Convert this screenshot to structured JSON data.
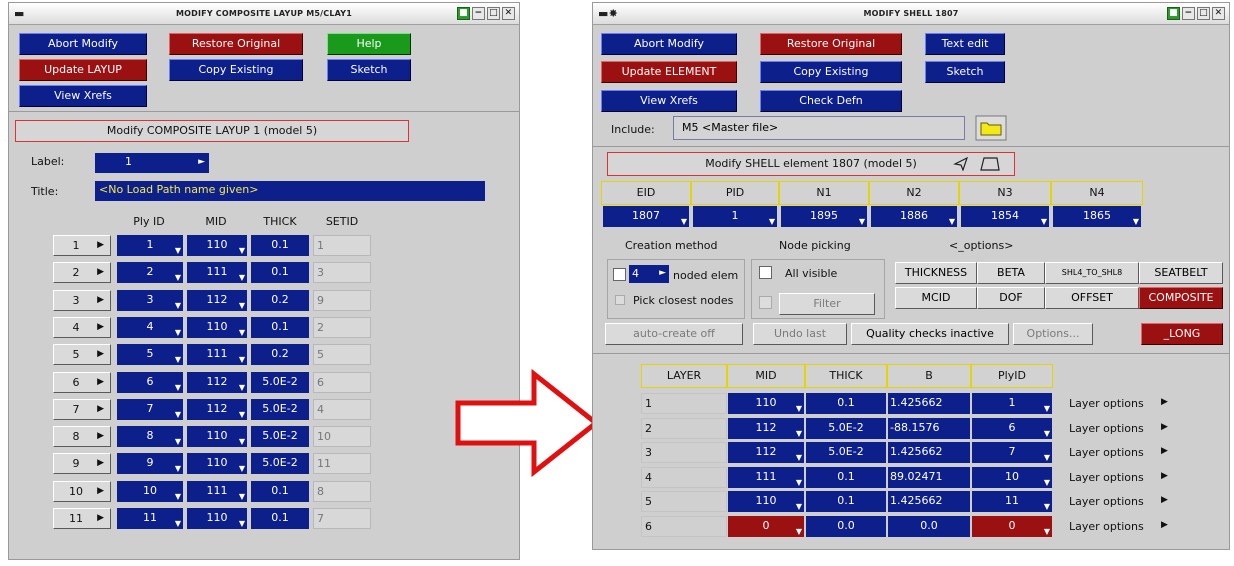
{
  "left_window": {
    "title": "MODIFY COMPOSITE LAYUP M5/CLAY1",
    "buttons": {
      "abort": "Abort Modify",
      "restore": "Restore Original",
      "help": "Help",
      "update": "Update LAYUP",
      "copy": "Copy Existing",
      "sketch": "Sketch",
      "xrefs": "View Xrefs"
    },
    "heading": "Modify COMPOSITE LAYUP 1 (model 5)",
    "label_caption": "Label:",
    "label_value": "1",
    "title_caption": "Title:",
    "title_value": "<No Load Path name given>",
    "columns": [
      "Ply ID",
      "MID",
      "THICK",
      "SETID"
    ],
    "plies": [
      {
        "row": "1",
        "ply": "1",
        "mid": "110",
        "thick": "0.1",
        "setid": "1"
      },
      {
        "row": "2",
        "ply": "2",
        "mid": "111",
        "thick": "0.1",
        "setid": "3"
      },
      {
        "row": "3",
        "ply": "3",
        "mid": "112",
        "thick": "0.2",
        "setid": "9"
      },
      {
        "row": "4",
        "ply": "4",
        "mid": "110",
        "thick": "0.1",
        "setid": "2"
      },
      {
        "row": "5",
        "ply": "5",
        "mid": "111",
        "thick": "0.2",
        "setid": "5"
      },
      {
        "row": "6",
        "ply": "6",
        "mid": "112",
        "thick": "5.0E-2",
        "setid": "6"
      },
      {
        "row": "7",
        "ply": "7",
        "mid": "112",
        "thick": "5.0E-2",
        "setid": "4"
      },
      {
        "row": "8",
        "ply": "8",
        "mid": "110",
        "thick": "5.0E-2",
        "setid": "10"
      },
      {
        "row": "9",
        "ply": "9",
        "mid": "110",
        "thick": "5.0E-2",
        "setid": "11"
      },
      {
        "row": "10",
        "ply": "10",
        "mid": "111",
        "thick": "0.1",
        "setid": "8"
      },
      {
        "row": "11",
        "ply": "11",
        "mid": "110",
        "thick": "0.1",
        "setid": "7"
      }
    ]
  },
  "right_window": {
    "title": "MODIFY SHELL 1807",
    "buttons": {
      "abort": "Abort Modify",
      "restore": "Restore Original",
      "text_edit": "Text edit",
      "update": "Update ELEMENT",
      "copy": "Copy Existing",
      "sketch": "Sketch",
      "xrefs": "View Xrefs",
      "check": "Check Defn"
    },
    "include_caption": "Include:",
    "include_value": "M5 <Master file>",
    "heading": "Modify SHELL element 1807 (model 5)",
    "element_headers": [
      "EID",
      "PID",
      "N1",
      "N2",
      "N3",
      "N4"
    ],
    "element_values": [
      "1807",
      "1",
      "1895",
      "1886",
      "1854",
      "1865"
    ],
    "creation_method": "Creation method",
    "node_picking": "Node picking",
    "options_label": "<_options>",
    "noded_count": "4",
    "noded_label": "noded elem",
    "pick_closest": "Pick closest nodes",
    "all_visible": "All visible",
    "filter": "Filter",
    "option_buttons": {
      "thickness": "THICKNESS",
      "beta": "BETA",
      "shl": "SHL4_TO_SHL8",
      "seatbelt": "SEATBELT",
      "mcid": "MCID",
      "dof": "DOF",
      "offset": "OFFSET",
      "composite": "COMPOSITE"
    },
    "auto_create": "auto-create off",
    "undo_last": "Undo last",
    "quality": "Quality checks inactive",
    "options_btn": "Options...",
    "long": "_LONG",
    "layer_headers": [
      "LAYER",
      "MID",
      "THICK",
      "B",
      "PlyID"
    ],
    "layers": [
      {
        "layer": "1",
        "mid": "110",
        "thick": "0.1",
        "b": "1.425662",
        "plyid": "1",
        "opt": "Layer options"
      },
      {
        "layer": "2",
        "mid": "112",
        "thick": "5.0E-2",
        "b": "-88.1576",
        "plyid": "6",
        "opt": "Layer options"
      },
      {
        "layer": "3",
        "mid": "112",
        "thick": "5.0E-2",
        "b": "1.425662",
        "plyid": "7",
        "opt": "Layer options"
      },
      {
        "layer": "4",
        "mid": "111",
        "thick": "0.1",
        "b": "89.02471",
        "plyid": "10",
        "opt": "Layer options"
      },
      {
        "layer": "5",
        "mid": "110",
        "thick": "0.1",
        "b": "1.425662",
        "plyid": "11",
        "opt": "Layer options"
      },
      {
        "layer": "6",
        "mid": "0",
        "thick": "0.0",
        "b": "0.0",
        "plyid": "0",
        "opt": "Layer options"
      }
    ]
  },
  "colors": {
    "arrow": "#e01010",
    "panel_blue": "#0c1f8a",
    "panel_red": "#9b1111",
    "panel_green": "#1a9a1a"
  }
}
